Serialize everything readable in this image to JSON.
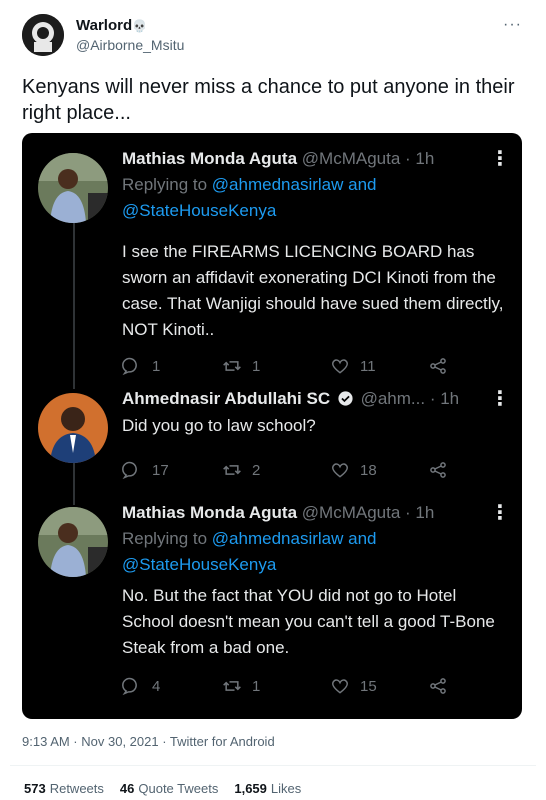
{
  "tweet": {
    "author_name": "Warlord",
    "author_emoji": "💀",
    "author_handle": "@Airborne_Msitu",
    "more_label": "···",
    "text": "Kenyans will never miss a chance to put anyone in their right place...",
    "timestamp": "9:13 AM · Nov 30, 2021 · Twitter for Android"
  },
  "stats": {
    "retweets_count": "573",
    "retweets_label": "Retweets",
    "quotes_count": "46",
    "quotes_label": "Quote Tweets",
    "likes_count": "1,659",
    "likes_label": "Likes"
  },
  "screenshot": {
    "replies": [
      {
        "name": "Mathias Monda Aguta",
        "handle": "@McMAguta",
        "time": "· 1h",
        "replying_prefix": "Replying to",
        "replying_to_1": "@ahmednasirlaw",
        "replying_and": "and",
        "replying_to_2": "@StateHouseKenya",
        "body": "I see the FIREARMS LICENCING BOARD has sworn an affidavit exonerating DCI Kinoti from the case. That Wanjigi should have sued them directly, NOT Kinoti..",
        "reply_count": "1",
        "retweet_count": "1",
        "like_count": "11"
      },
      {
        "name": "Ahmednasir Abdullahi SC",
        "handle": "@ahm...",
        "time": "· 1h",
        "body": "Did you go to law school?",
        "reply_count": "17",
        "retweet_count": "2",
        "like_count": "18"
      },
      {
        "name": "Mathias Monda Aguta",
        "handle": "@McMAguta",
        "time": "· 1h",
        "replying_prefix": "Replying to",
        "replying_to_1": "@ahmednasirlaw",
        "replying_and": "and",
        "replying_to_2": "@StateHouseKenya",
        "body": "No. But the fact that YOU did not go to Hotel School doesn't mean you can't tell a good T-Bone Steak from a bad one.",
        "reply_count": "4",
        "retweet_count": "1",
        "like_count": "15"
      }
    ]
  }
}
